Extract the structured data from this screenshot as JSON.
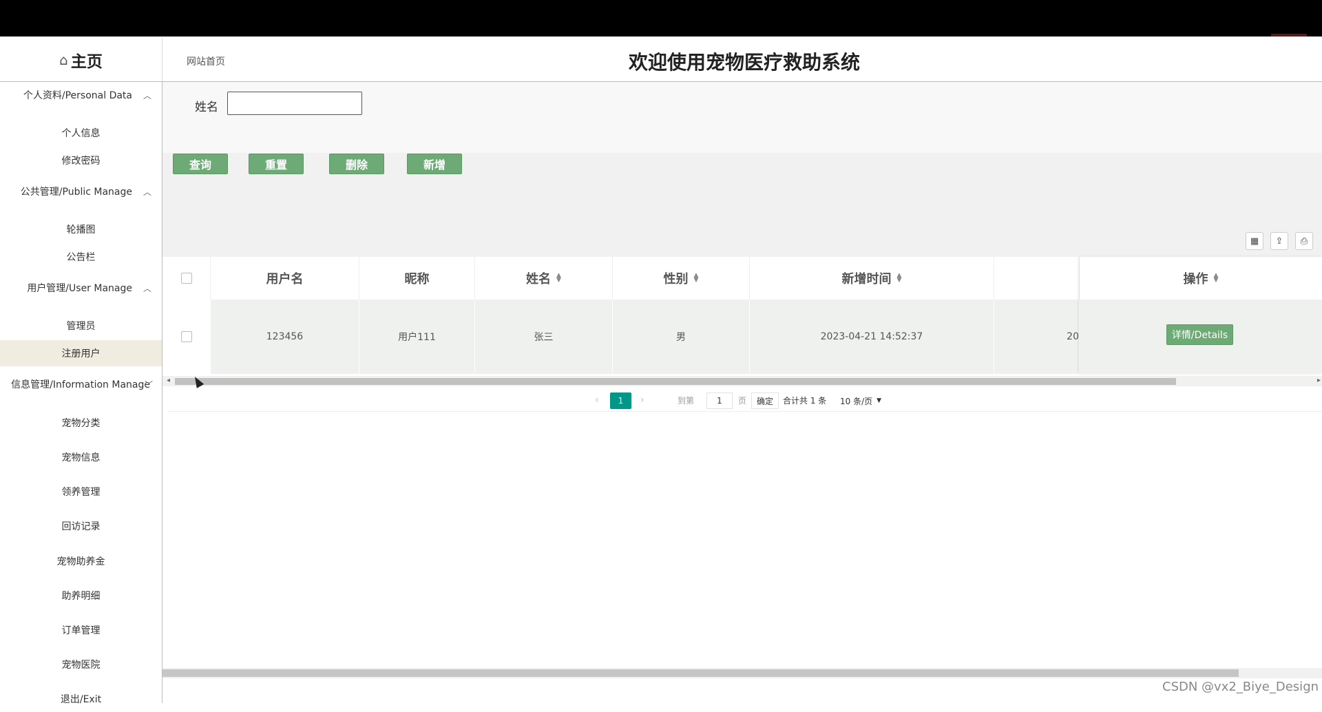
{
  "header": {
    "logo_label": "主页",
    "breadcrumb": "网站首页",
    "site_title": "欢迎使用宠物医疗救助系统"
  },
  "sidebar": {
    "groups": [
      {
        "label": "个人资料/Personal Data",
        "items": [
          "个人信息",
          "修改密码"
        ]
      },
      {
        "label": "公共管理/Public Manage",
        "items": [
          "轮播图",
          "公告栏"
        ]
      },
      {
        "label": "用户管理/User Manage",
        "items": [
          "管理员",
          "注册用户"
        ]
      },
      {
        "label": "信息管理/Information Manage",
        "items": [
          "宠物分类",
          "宠物信息",
          "领养管理",
          "回访记录",
          "宠物助养金",
          "助养明细",
          "订单管理",
          "宠物医院"
        ]
      }
    ],
    "exit_label": "退出/Exit",
    "active_item": "注册用户"
  },
  "search": {
    "label": "姓名",
    "value": ""
  },
  "buttons": {
    "query": "查询",
    "reset": "重置",
    "delete": "删除",
    "add": "新增"
  },
  "table": {
    "headers": [
      "用户名",
      "昵称",
      "姓名",
      "性别",
      "新增时间",
      "操作"
    ],
    "rows": [
      {
        "username": "123456",
        "nickname": "用户111",
        "name": "张三",
        "gender": "男",
        "created": "2023-04-21 14:52:37",
        "partial": "20",
        "action": "详情/Details"
      }
    ]
  },
  "pager": {
    "current_page": "1",
    "goto_label": "到第",
    "goto_value": "1",
    "page_unit": "页",
    "confirm": "确定",
    "total": "合计共 1 条",
    "page_size": "10 条/页"
  },
  "watermark": "CSDN @vx2_Biye_Design"
}
